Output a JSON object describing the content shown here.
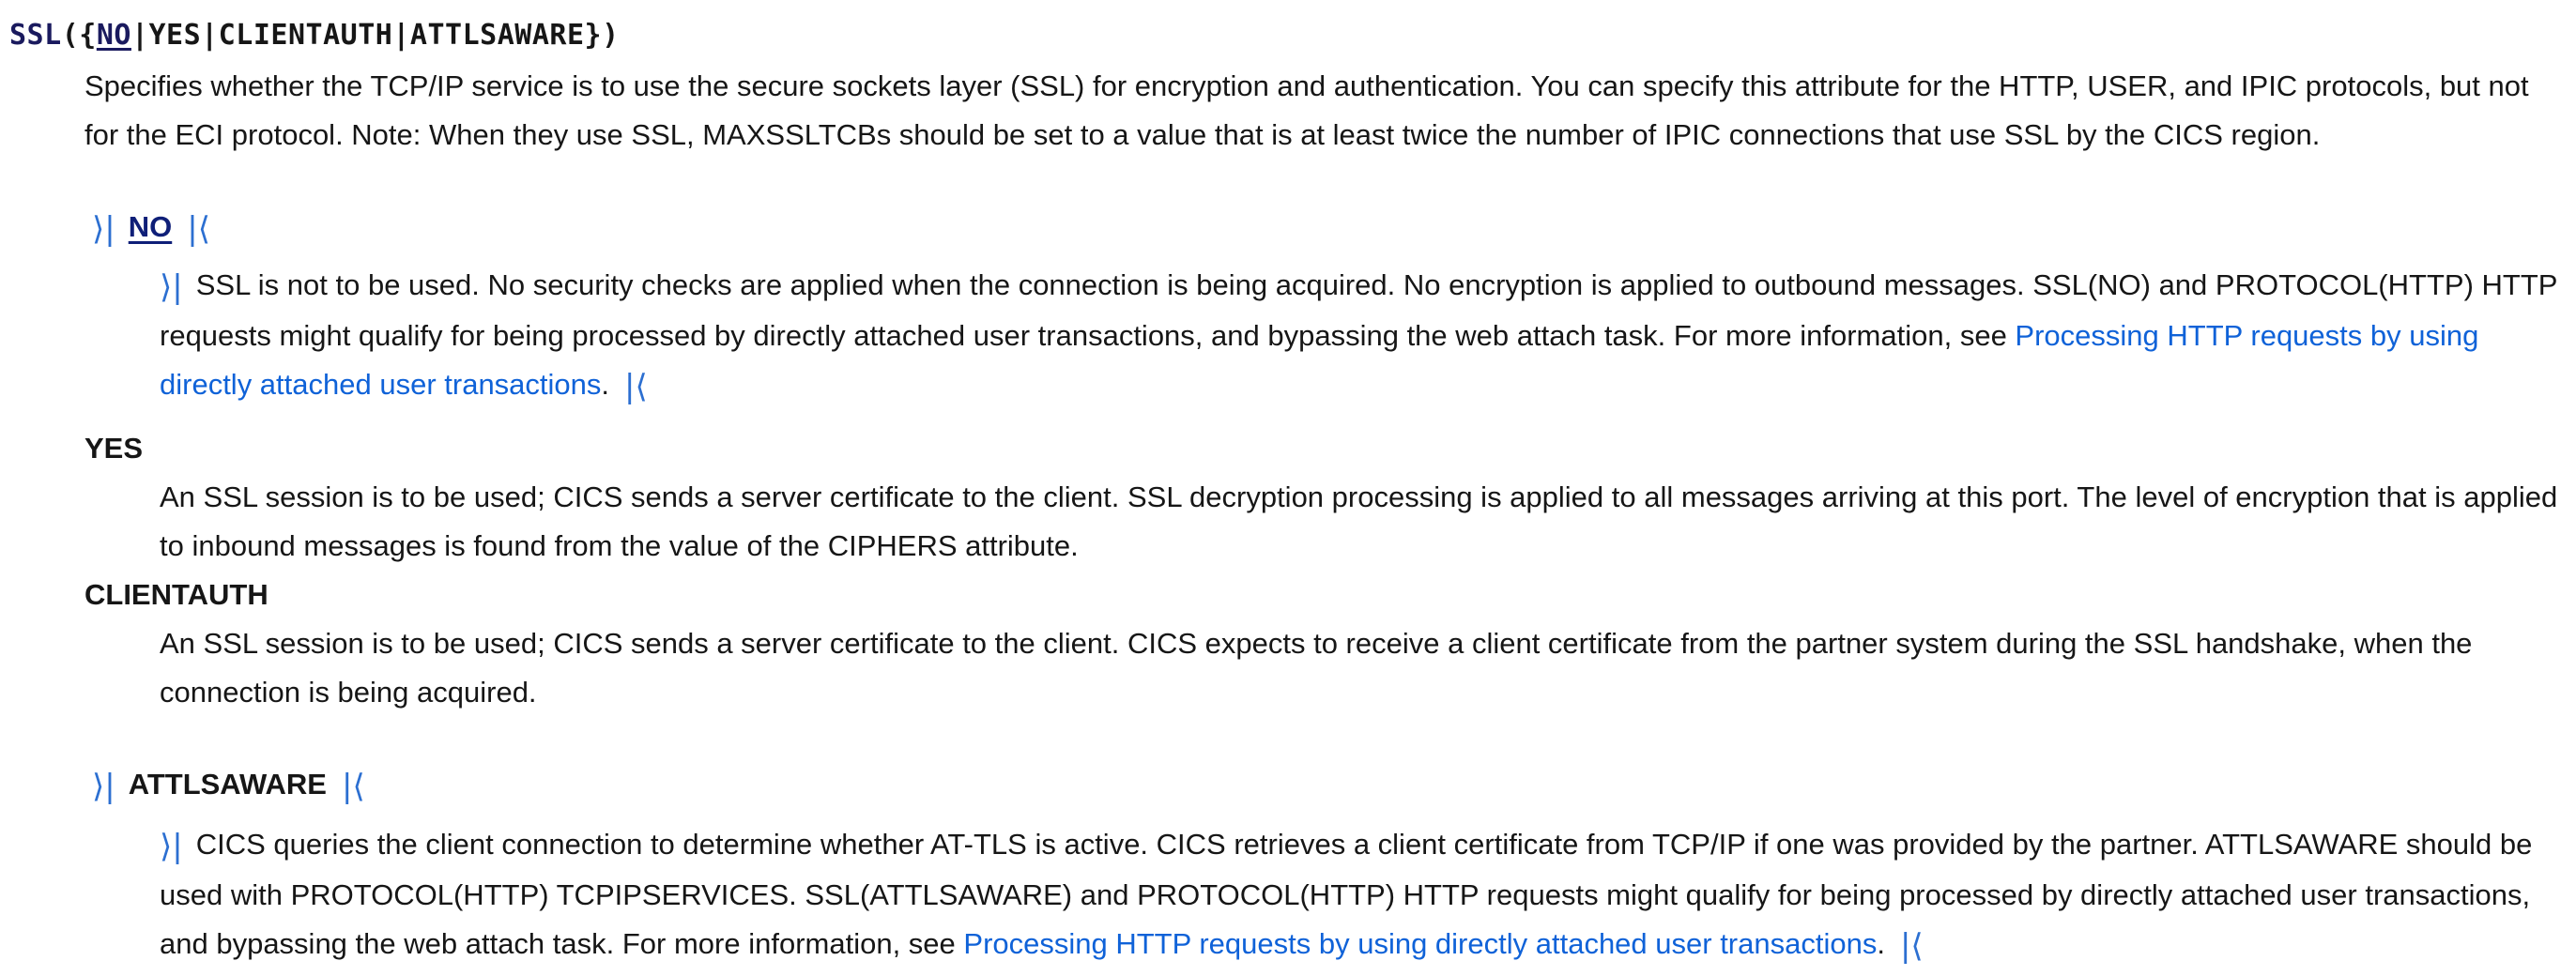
{
  "syntax": {
    "keyword": "SSL",
    "open": "({",
    "default": "NO",
    "rest": "|YES|CLIENTAUTH|ATTLSAWARE}",
    "close": ")"
  },
  "intro": "Specifies whether the TCP/IP service is to use the secure sockets layer (SSL) for encryption and authentication. You can specify this attribute for the HTTP, USER, and IPIC protocols, but not for the ECI protocol. Note: When they use SSL, MAXSSLTCBs should be set to a value that is at least twice the number of IPIC connections that use SSL by the CICS region.",
  "change_marks": {
    "start": "⟩|",
    "end": "|⟨"
  },
  "options": [
    {
      "term": "NO",
      "desc": "SSL is not to be used. No security checks are applied when the connection is being acquired. No encryption is applied to outbound messages. SSL(NO) and PROTOCOL(HTTP) HTTP requests might qualify for being processed by directly attached user transactions, and bypassing the web attach task. For more information, see ",
      "link": "Processing HTTP requests by using directly attached user transactions",
      "tail": "."
    },
    {
      "term": "YES",
      "desc": "An SSL session is to be used; CICS sends a server certificate to the client. SSL decryption processing is applied to all messages arriving at this port. The level of encryption that is applied to inbound messages is found from the value of the CIPHERS attribute."
    },
    {
      "term": "CLIENTAUTH",
      "desc": "An SSL session is to be used; CICS sends a server certificate to the client. CICS expects to receive a client certificate from the partner system during the SSL handshake, when the connection is being acquired."
    },
    {
      "term": "ATTLSAWARE",
      "desc": "CICS queries the client connection to determine whether AT-TLS is active. CICS retrieves a client certificate from TCP/IP if one was provided by the partner. ATTLSAWARE should be used with PROTOCOL(HTTP) TCPIPSERVICES. SSL(ATTLSAWARE) and PROTOCOL(HTTP) HTTP requests might qualify for being processed by directly attached user transactions, and bypassing the web attach task. For more information, see ",
      "link": "Processing HTTP requests by using directly attached user transactions",
      "tail": "."
    }
  ]
}
